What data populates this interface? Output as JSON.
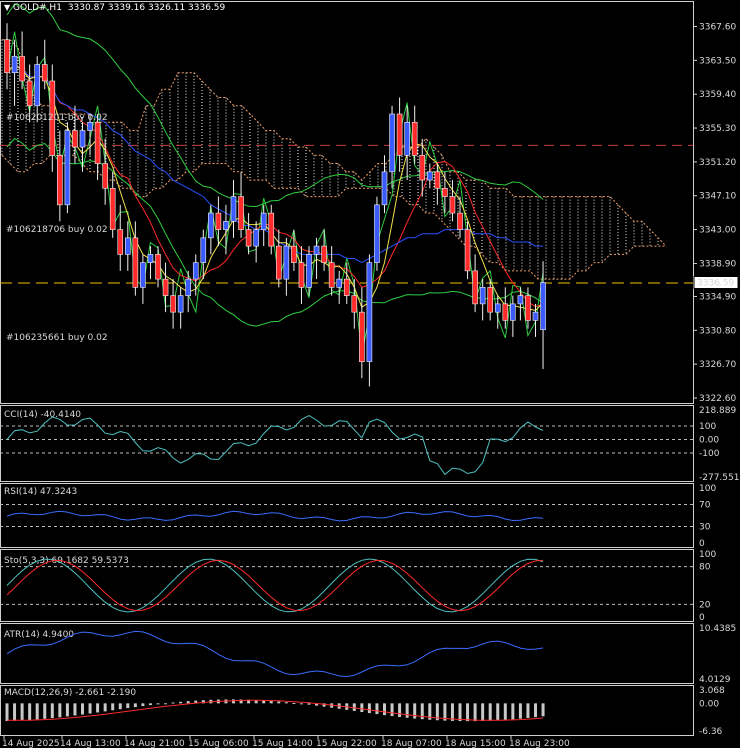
{
  "header": {
    "symbol": "GOLD#,H1",
    "ohlc": "3330.87 3339.16 3326.11 3336.59"
  },
  "price_scale": [
    "3367.60",
    "3363.50",
    "3359.40",
    "3355.30",
    "3351.20",
    "3347.10",
    "3343.00",
    "3338.90",
    "3334.90",
    "3330.80",
    "3326.70",
    "3322.60"
  ],
  "current_price": "3336.59",
  "orders": [
    {
      "id": "#106201201",
      "label": "#106201201 buy 0.02"
    },
    {
      "id": "#106218706",
      "label": "#106218706 buy 0.02"
    },
    {
      "id": "#106235661",
      "label": "#106235661 buy 0.02"
    }
  ],
  "time_axis": [
    "14 Aug 2025",
    "14 Aug 13:00",
    "14 Aug 21:00",
    "15 Aug 06:00",
    "15 Aug 14:00",
    "15 Aug 22:00",
    "18 Aug 07:00",
    "18 Aug 15:00",
    "18 Aug 23:00"
  ],
  "indicators": {
    "cci": {
      "label": "CCI(14) -40.4140",
      "levels": [
        "218.889",
        "100",
        "0.00",
        "-100",
        "-277.5515"
      ]
    },
    "rsi": {
      "label": "RSI(14) 47.3243",
      "levels": [
        "100",
        "70",
        "30",
        "0"
      ]
    },
    "stoch": {
      "label": "Sto(5,3,3) 69.1682 59.5373",
      "levels": [
        "100",
        "80",
        "20",
        "0"
      ]
    },
    "atr": {
      "label": "ATR(14) 4.9400",
      "levels": [
        "10.4385",
        "4.0129"
      ]
    },
    "macd": {
      "label": "MACD(12,26,9) -2.661 -2.190",
      "levels": [
        "3.068",
        "0.00",
        "-6.36"
      ]
    }
  },
  "colors": {
    "bull": "#3b5bff",
    "bear": "#ff2a2a",
    "kumo": "#f4a06a",
    "ma_red": "#ff2a2a",
    "ma_blue": "#2850ff",
    "ma_yellow": "#f2e24a",
    "bollinger": "#2ecc40",
    "cci": "#4fc1c1",
    "rsi": "#3a6cff",
    "stoch_main": "#4fc1c1",
    "stoch_signal": "#ff2a2a",
    "atr": "#3a6cff",
    "macd_hist": "#c8c8c8",
    "macd_signal": "#ff2a2a",
    "price_line": "#f2c200",
    "resistance": "#c83c3c"
  },
  "chart_data": {
    "type": "candlestick",
    "title": "GOLD#,H1",
    "ylim": [
      3322.6,
      3369.6
    ],
    "levels": {
      "resistance": 3353.2,
      "current": 3336.59,
      "order_1": 3353.2,
      "order_2": 3343.0
    },
    "candles": [
      [
        3366,
        3368,
        3360,
        3362
      ],
      [
        3362,
        3366,
        3358,
        3364
      ],
      [
        3364,
        3367,
        3360,
        3361
      ],
      [
        3361,
        3363,
        3356,
        3358
      ],
      [
        3358,
        3364,
        3356,
        3363
      ],
      [
        3363,
        3366,
        3360,
        3361
      ],
      [
        3361,
        3363,
        3350,
        3352
      ],
      [
        3352,
        3355,
        3344,
        3346
      ],
      [
        3346,
        3356,
        3345,
        3355
      ],
      [
        3355,
        3358,
        3351,
        3353
      ],
      [
        3353,
        3356,
        3350,
        3355
      ],
      [
        3355,
        3357,
        3352,
        3356
      ],
      [
        3356,
        3357,
        3349,
        3351
      ],
      [
        3351,
        3354,
        3346,
        3348
      ],
      [
        3348,
        3350,
        3342,
        3343
      ],
      [
        3343,
        3346,
        3338,
        3340
      ],
      [
        3340,
        3344,
        3338,
        3342
      ],
      [
        3342,
        3344,
        3335,
        3336
      ],
      [
        3336,
        3340,
        3334,
        3339
      ],
      [
        3339,
        3341,
        3337,
        3340
      ],
      [
        3340,
        3341,
        3336,
        3337
      ],
      [
        3337,
        3339,
        3333,
        3335
      ],
      [
        3335,
        3337,
        3331,
        3333
      ],
      [
        3333,
        3336,
        3331,
        3335
      ],
      [
        3335,
        3338,
        3333,
        3337
      ],
      [
        3337,
        3340,
        3335,
        3339
      ],
      [
        3339,
        3343,
        3337,
        3342
      ],
      [
        3342,
        3346,
        3340,
        3345
      ],
      [
        3345,
        3347,
        3341,
        3343
      ],
      [
        3343,
        3346,
        3340,
        3344
      ],
      [
        3344,
        3349,
        3342,
        3347
      ],
      [
        3347,
        3350,
        3342,
        3343
      ],
      [
        3343,
        3345,
        3340,
        3341
      ],
      [
        3341,
        3344,
        3339,
        3343
      ],
      [
        3343,
        3346,
        3341,
        3345
      ],
      [
        3345,
        3346,
        3340,
        3341
      ],
      [
        3341,
        3343,
        3336,
        3337
      ],
      [
        3337,
        3342,
        3335,
        3341
      ],
      [
        3341,
        3343,
        3338,
        3339
      ],
      [
        3339,
        3341,
        3334,
        3336
      ],
      [
        3336,
        3341,
        3335,
        3340
      ],
      [
        3340,
        3342,
        3337,
        3341
      ],
      [
        3341,
        3343,
        3338,
        3339
      ],
      [
        3339,
        3341,
        3335,
        3336
      ],
      [
        3336,
        3338,
        3334,
        3337
      ],
      [
        3337,
        3339,
        3334,
        3335
      ],
      [
        3335,
        3337,
        3331,
        3333
      ],
      [
        3333,
        3336,
        3325,
        3327
      ],
      [
        3327,
        3340,
        3324,
        3339
      ],
      [
        3339,
        3347,
        3338,
        3346
      ],
      [
        3346,
        3352,
        3345,
        3350
      ],
      [
        3350,
        3358,
        3348,
        3357
      ],
      [
        3357,
        3359,
        3350,
        3352
      ],
      [
        3352,
        3358,
        3349,
        3356
      ],
      [
        3356,
        3358,
        3351,
        3352
      ],
      [
        3352,
        3354,
        3347,
        3349
      ],
      [
        3349,
        3351,
        3348,
        3350
      ],
      [
        3350,
        3351,
        3346,
        3348
      ],
      [
        3348,
        3350,
        3345,
        3347
      ],
      [
        3347,
        3349,
        3344,
        3345
      ],
      [
        3345,
        3347,
        3342,
        3343
      ],
      [
        3343,
        3344,
        3337,
        3338
      ],
      [
        3338,
        3340,
        3333,
        3334
      ],
      [
        3334,
        3337,
        3332,
        3336
      ],
      [
        3336,
        3337,
        3332,
        3333
      ],
      [
        3333,
        3335,
        3331,
        3334
      ],
      [
        3334,
        3336,
        3331,
        3332
      ],
      [
        3332,
        3335,
        3330,
        3334
      ],
      [
        3334,
        3336,
        3332,
        3335
      ],
      [
        3335,
        3336,
        3331,
        3332
      ],
      [
        3332,
        3334,
        3330,
        3333
      ],
      [
        3330.87,
        3339.16,
        3326.11,
        3336.59
      ]
    ]
  }
}
